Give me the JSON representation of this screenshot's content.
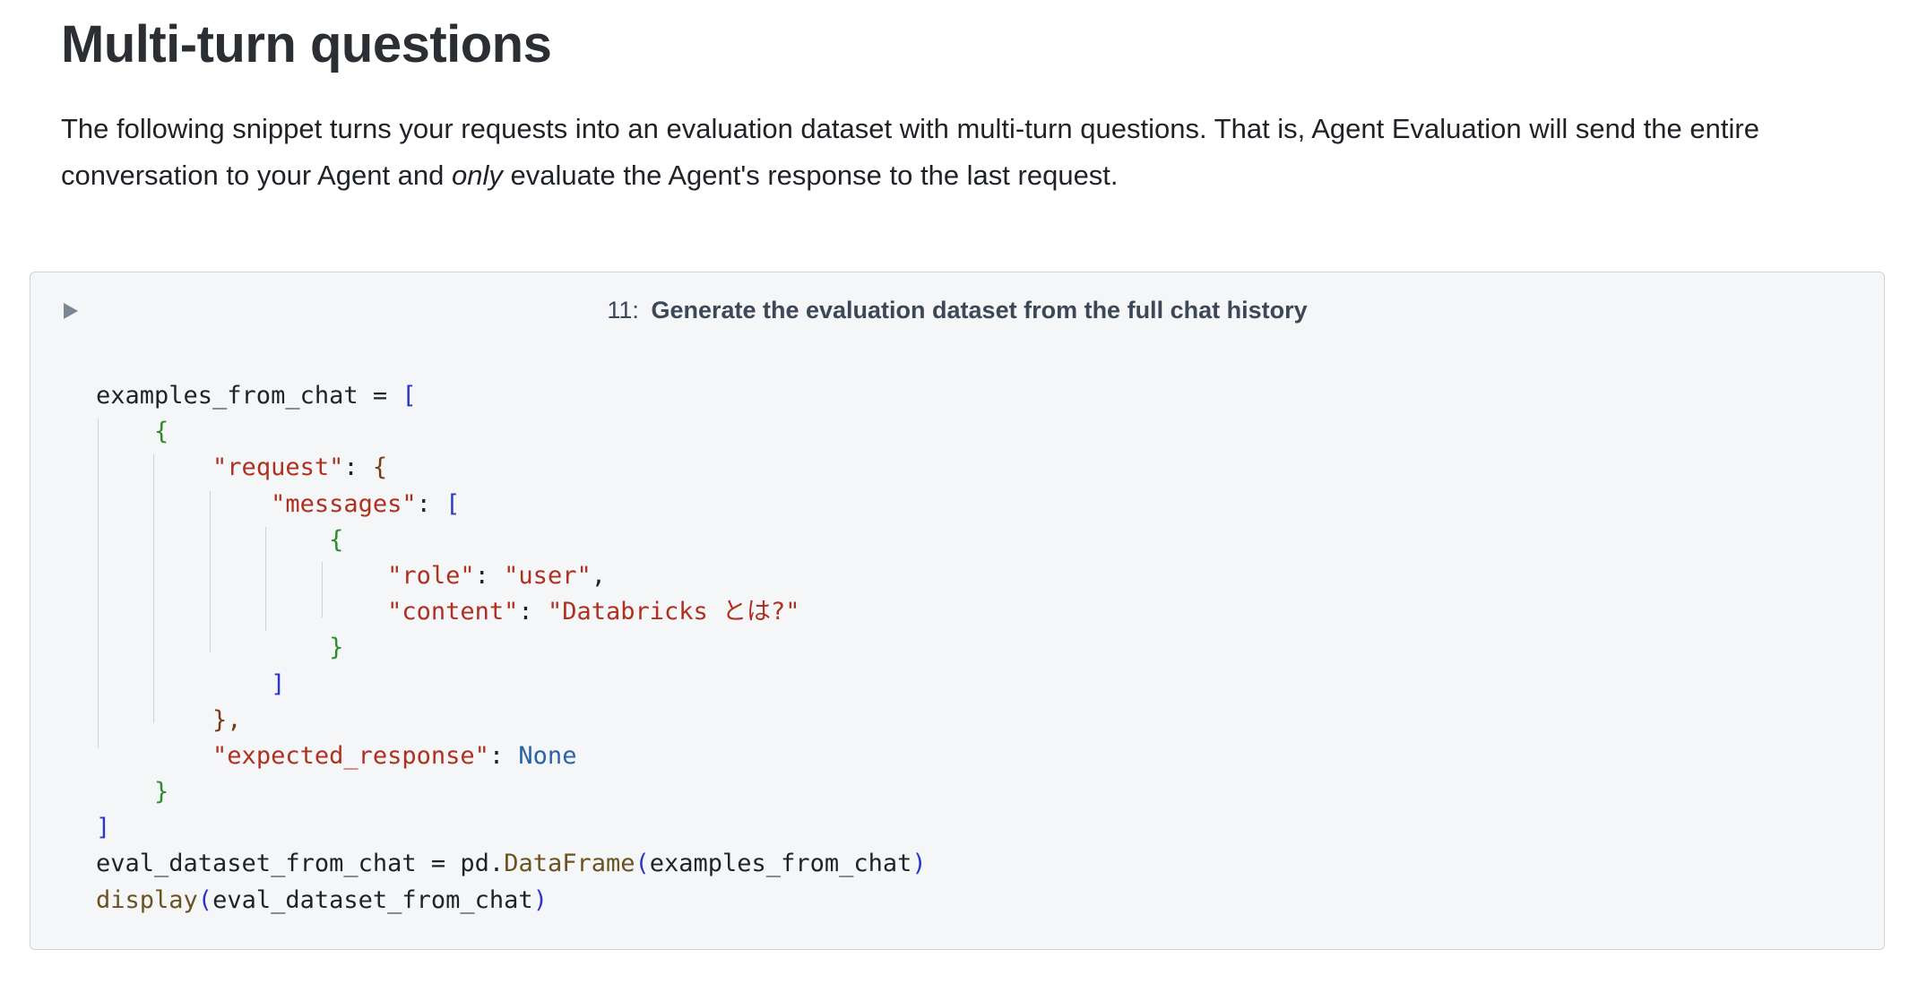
{
  "section": {
    "heading": "Multi-turn questions",
    "paragraph": {
      "part1": "The following snippet turns your requests into an evaluation dataset with multi-turn questions. That is, Agent Evaluation will send the entire conversation to your Agent and ",
      "emphasis": "only",
      "part2": " evaluate the Agent's response to the last request."
    }
  },
  "cell": {
    "number": "11:",
    "title": "Generate the evaluation dataset from the full chat history",
    "toggle_icon": "triangle-right-icon",
    "code": {
      "var_examples": "examples_from_chat",
      "op_eq": " = ",
      "open_list": "[",
      "open_dict": "{",
      "key_request": "\"request\"",
      "colon": ": ",
      "key_messages": "\"messages\"",
      "key_role": "\"role\"",
      "val_user": "\"user\"",
      "comma": ",",
      "key_content": "\"content\"",
      "val_content": "\"Databricks とは?\"",
      "close_dict": "}",
      "close_list": "]",
      "close_dict_comma": "},",
      "key_expected": "\"expected_response\"",
      "val_none": "None",
      "var_eval": "eval_dataset_from_chat",
      "pd_prefix": "pd.",
      "fn_dataframe": "DataFrame",
      "paren_open": "(",
      "paren_close": ")",
      "arg_examples": "examples_from_chat",
      "fn_display": "display",
      "arg_eval": "eval_dataset_from_chat"
    }
  },
  "colors": {
    "cell_background": "#f5f6f8",
    "string": "#b0301f",
    "keyword": "#2a62a8",
    "function": "#6b5220",
    "bracket_level1": "#2a35c9",
    "bracket_level2": "#2e8b2e",
    "bracket_level3": "#7a3a14"
  }
}
